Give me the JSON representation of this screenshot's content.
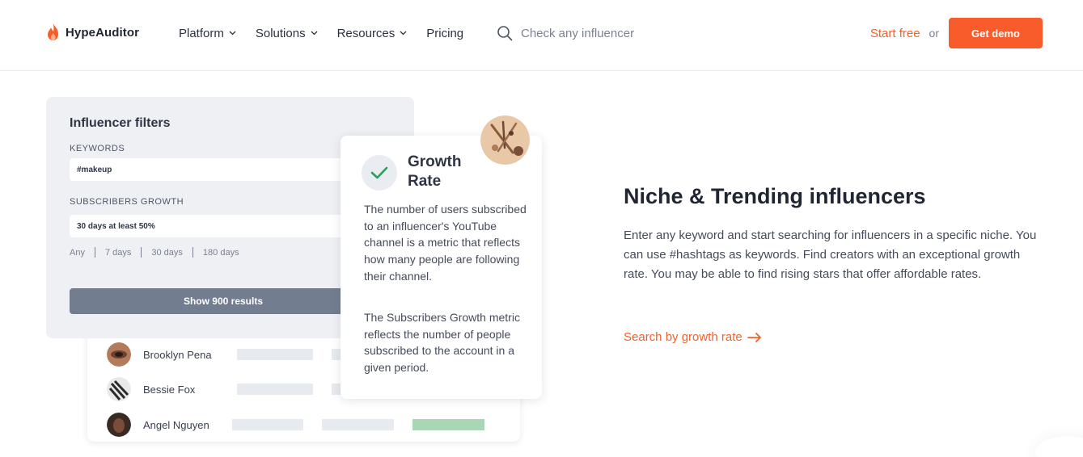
{
  "header": {
    "logo_text": "HypeAuditor",
    "nav": [
      {
        "label": "Platform"
      },
      {
        "label": "Solutions"
      },
      {
        "label": "Resources"
      },
      {
        "label": "Pricing"
      }
    ],
    "search_placeholder": "Check any influencer",
    "start_free": "Start free",
    "or": "or",
    "demo": "Get demo"
  },
  "filters": {
    "title": "Influencer filters",
    "keywords_label": "KEYWORDS",
    "keywords_value": "#makeup",
    "growth_label": "SUBSCRIBERS GROWTH",
    "growth_value": "30 days at least 50%",
    "periods": [
      "Any",
      "7 days",
      "30 days",
      "180 days"
    ],
    "show_button": "Show 900 results"
  },
  "influencers": [
    {
      "name": "Brooklyn Pena"
    },
    {
      "name": "Bessie Fox"
    },
    {
      "name": "Angel Nguyen"
    }
  ],
  "tooltip": {
    "title": "Growth Rate",
    "p1": "The number of users subscribed to an influencer's YouTube channel is a metric that reflects how many people are following their channel.",
    "p2": "The Subscribers Growth metric reflects the number of people subscribed to the account in a given period."
  },
  "feature": {
    "title": "Niche & Trending influencers",
    "description": "Enter any keyword and start searching for influencers in a specific niche. You can use #hashtags as keywords. Find creators with an exceptional growth rate. You may be able to find rising stars that offer affordable rates.",
    "link": "Search by growth rate"
  },
  "colors": {
    "accent": "#f95c2b",
    "link": "#f4602a",
    "card_bg": "#eef0f4",
    "button_gray": "#737d90",
    "check_green": "#2e9e5b",
    "bar_green": "#a9d6b4"
  }
}
